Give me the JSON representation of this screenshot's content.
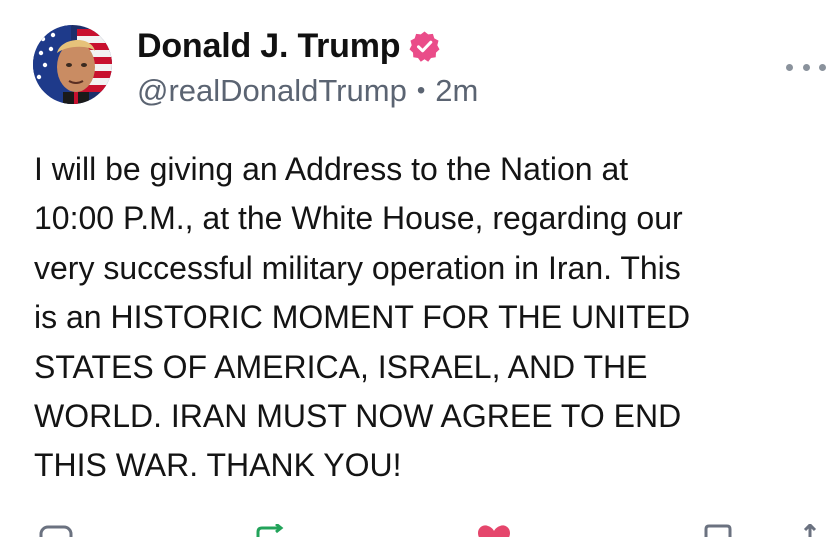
{
  "author": {
    "display_name": "Donald J. Trump",
    "handle": "@realDonaldTrump",
    "separator": "•",
    "timestamp": "2m",
    "verified_icon": "verified-badge-icon",
    "verified_color": "#ea4c89"
  },
  "post": {
    "text": "I will be giving an Address to the Nation at\n10:00 P.M., at the White House, regarding our\nvery successful military operation in Iran. This\nis an HISTORIC MOMENT FOR THE UNITED\nSTATES OF AMERICA, ISRAEL, AND THE\nWORLD. IRAN MUST NOW AGREE TO END\nTHIS WAR. THANK YOU!"
  },
  "menu": {
    "icon": "more-options-icon"
  },
  "actions": [
    {
      "icon": "reply-icon",
      "color": "#6b7280"
    },
    {
      "icon": "retruth-icon",
      "color": "#22a35a"
    },
    {
      "icon": "like-icon",
      "color": "#e5466c"
    },
    {
      "icon": "bookmark-icon",
      "color": "#6b7280"
    },
    {
      "icon": "share-icon",
      "color": "#6b7280"
    }
  ],
  "colors": {
    "text": "#141414",
    "muted": "#5b6472"
  }
}
